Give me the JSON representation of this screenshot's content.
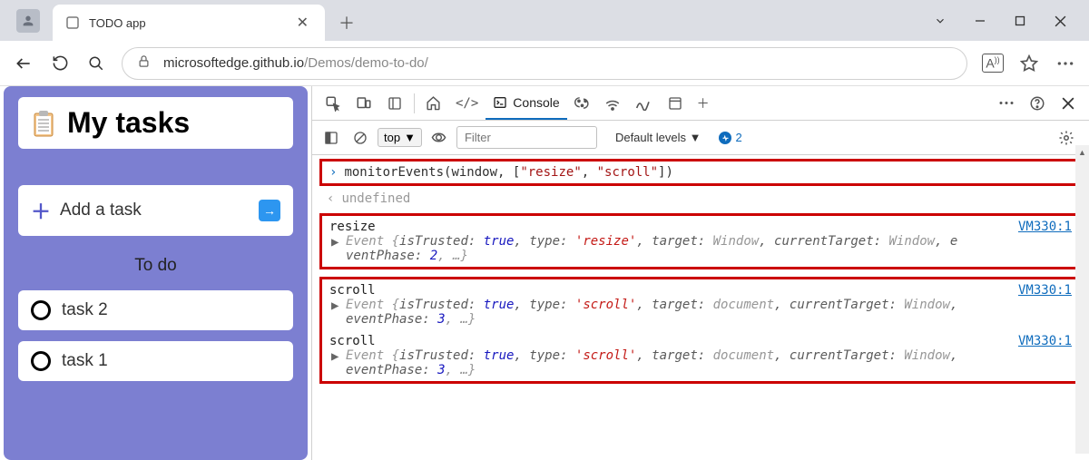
{
  "window": {
    "tab_title": "TODO app"
  },
  "nav": {
    "url_host": "microsoftedge.github.io",
    "url_path": "/Demos/demo-to-do/"
  },
  "app": {
    "title": "My tasks",
    "add_label": "Add a task",
    "section": "To do",
    "tasks": [
      "task 2",
      "task 1"
    ]
  },
  "devtools": {
    "console_label": "Console",
    "top_label": "top",
    "filter_placeholder": "Filter",
    "levels_label": "Default levels",
    "issue_count": "2",
    "command": {
      "prefix": "monitorEvents(window, [",
      "arg1": "\"resize\"",
      "sep": ", ",
      "arg2": "\"scroll\"",
      "suffix": "])"
    },
    "return_value": "undefined",
    "logs": [
      {
        "name": "resize",
        "source": "VM330:1",
        "detail_prefix": "Event {",
        "isTrusted_k": "isTrusted: ",
        "isTrusted_v": "true",
        "type_k": ", type: ",
        "type_v": "'resize'",
        "target_k": ", target: ",
        "target_v": "Window",
        "ct_k": ", currentTarget: ",
        "ct_v": "Window",
        "tail": ", e",
        "line2_a": "ventPhase: ",
        "line2_b": "2",
        "line2_c": ", …}"
      },
      {
        "name": "scroll",
        "source": "VM330:1",
        "detail_prefix": "Event {",
        "isTrusted_k": "isTrusted: ",
        "isTrusted_v": "true",
        "type_k": ", type: ",
        "type_v": "'scroll'",
        "target_k": ", target: ",
        "target_v": "document",
        "ct_k": ", currentTarget: ",
        "ct_v": "Window",
        "tail": ", ",
        "line2_a": "eventPhase: ",
        "line2_b": "3",
        "line2_c": ", …}"
      },
      {
        "name": "scroll",
        "source": "VM330:1",
        "detail_prefix": "Event {",
        "isTrusted_k": "isTrusted: ",
        "isTrusted_v": "true",
        "type_k": ", type: ",
        "type_v": "'scroll'",
        "target_k": ", target: ",
        "target_v": "document",
        "ct_k": ", currentTarget: ",
        "ct_v": "Window",
        "tail": ", ",
        "line2_a": "eventPhase: ",
        "line2_b": "3",
        "line2_c": ", …}"
      }
    ]
  }
}
